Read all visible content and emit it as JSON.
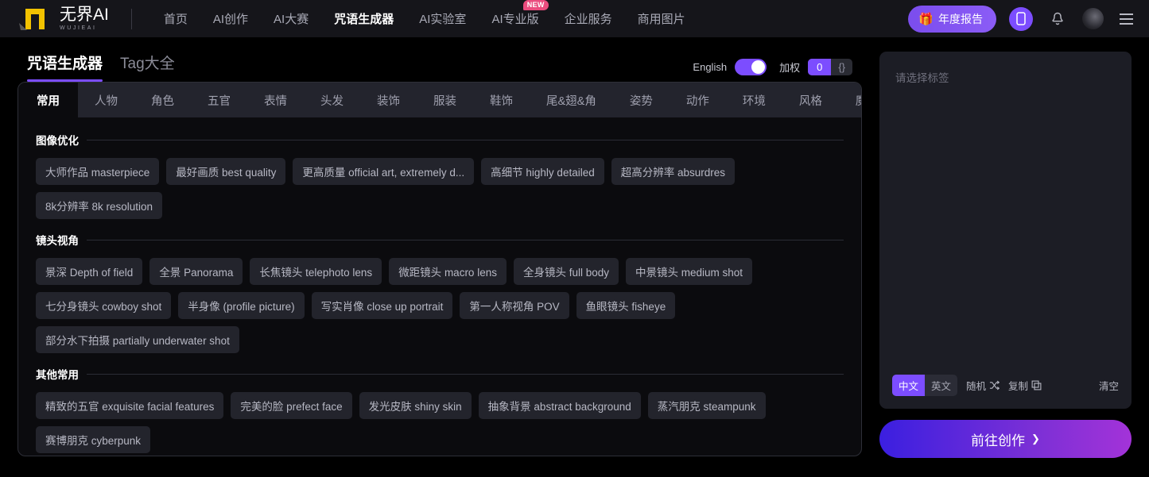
{
  "navbar": {
    "logo": {
      "name": "无界AI",
      "sub": "WUJIEAI"
    },
    "links": [
      {
        "label": "首页",
        "active": false
      },
      {
        "label": "AI创作",
        "active": false
      },
      {
        "label": "AI大赛",
        "active": false
      },
      {
        "label": "咒语生成器",
        "active": true
      },
      {
        "label": "AI实验室",
        "active": false
      },
      {
        "label": "AI专业版",
        "active": false,
        "badge": "NEW"
      },
      {
        "label": "企业服务",
        "active": false
      },
      {
        "label": "商用图片",
        "active": false
      }
    ],
    "report_button": {
      "label": "年度报告",
      "icon": "gift-icon"
    },
    "icons": [
      "mobile-icon",
      "bell-icon",
      "avatar",
      "menu-icon"
    ]
  },
  "page_tabs": [
    {
      "label": "咒语生成器",
      "active": true
    },
    {
      "label": "Tag大全",
      "active": false
    }
  ],
  "controls": {
    "lang_label": "English",
    "lang_on": true,
    "weight_label": "加权",
    "weight_value": "0",
    "weight_brace": "{}"
  },
  "categories": [
    {
      "label": "常用",
      "active": true
    },
    {
      "label": "人物",
      "active": false
    },
    {
      "label": "角色",
      "active": false
    },
    {
      "label": "五官",
      "active": false
    },
    {
      "label": "表情",
      "active": false
    },
    {
      "label": "头发",
      "active": false
    },
    {
      "label": "装饰",
      "active": false
    },
    {
      "label": "服装",
      "active": false
    },
    {
      "label": "鞋饰",
      "active": false
    },
    {
      "label": "尾&翅&角",
      "active": false
    },
    {
      "label": "姿势",
      "active": false
    },
    {
      "label": "动作",
      "active": false
    },
    {
      "label": "环境",
      "active": false
    },
    {
      "label": "风格",
      "active": false
    },
    {
      "label": "魔法",
      "active": false
    }
  ],
  "sections": [
    {
      "title": "图像优化",
      "tags": [
        "大师作品 masterpiece",
        "最好画质 best quality",
        "更高质量 official art, extremely d...",
        "高细节 highly detailed",
        "超高分辨率 absurdres",
        "8k分辨率 8k resolution"
      ]
    },
    {
      "title": "镜头视角",
      "tags": [
        "景深 Depth of field",
        "全景 Panorama",
        "长焦镜头 telephoto lens",
        "微距镜头 macro lens",
        "全身镜头 full body",
        "中景镜头 medium shot",
        "七分身镜头 cowboy shot",
        "半身像 (profile picture)",
        "写实肖像 close up portrait",
        "第一人称视角 POV",
        "鱼眼镜头 fisheye",
        "部分水下拍摄 partially underwater shot"
      ]
    },
    {
      "title": "其他常用",
      "tags": [
        "精致的五官 exquisite facial features",
        "完美的脸 prefect face",
        "发光皮肤 shiny skin",
        "抽象背景 abstract background",
        "蒸汽朋克 steampunk",
        "赛博朋克 cyberpunk"
      ]
    }
  ],
  "prompt_panel": {
    "placeholder": "请选择标签",
    "lang_options": [
      {
        "label": "中文",
        "active": true
      },
      {
        "label": "英文",
        "active": false
      }
    ],
    "random_label": "随机",
    "copy_label": "复制",
    "clear_label": "清空"
  },
  "cta": {
    "label": "前往创作",
    "chevron": "❯"
  },
  "colors": {
    "accent": "#7c4dff",
    "badge": "#ea4c7e",
    "panel_bg": "#0b0b0e",
    "tag_bg": "#23242c"
  }
}
